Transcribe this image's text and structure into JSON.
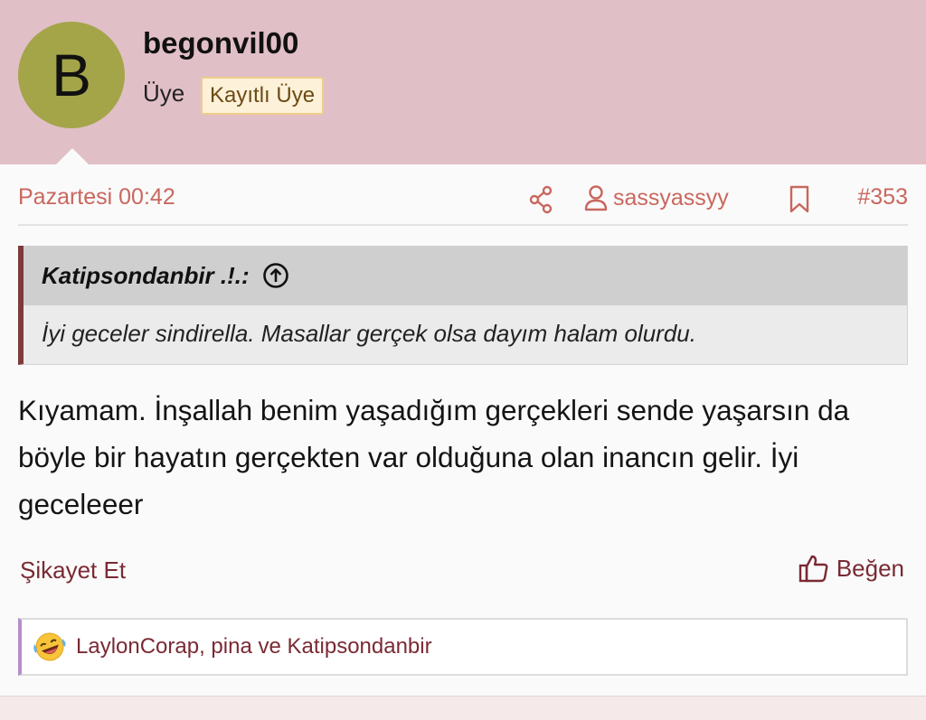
{
  "user": {
    "avatar_letter": "B",
    "username": "begonvil00",
    "role": "Üye",
    "badge": "Kayıtlı Üye"
  },
  "meta": {
    "date": "Pazartesi 00:42",
    "mentioned_user": "sassyassyy",
    "post_number": "#353"
  },
  "quote": {
    "author": "Katipsondanbir .!.:",
    "text": "İyi geceler sindirella. Masallar gerçek olsa dayım halam olurdu."
  },
  "message": {
    "text": "Kıyamam. İnşallah benim yaşadığım gerçekleri sende yaşarsın da böyle bir hayatın gerçekten var olduğuna olan inancın gelir. İyi geceleeer"
  },
  "actions": {
    "report": "Şikayet Et",
    "like": "Beğen"
  },
  "reactions": {
    "users": "LaylonCorap, pina ve Katipsondanbir"
  },
  "colors": {
    "header_bg": "#e1bfc7",
    "avatar_bg": "#a3a548",
    "meta_accent": "#c9675e",
    "action_link": "#7a2a34",
    "quote_border": "#7d3b39"
  },
  "icons": {
    "share": "share-icon",
    "user": "user-icon",
    "bookmark": "bookmark-icon",
    "quote_up": "arrow-up-circle-icon",
    "like": "thumbs-up-icon",
    "reaction": "laughing-tears-emoji-icon"
  }
}
